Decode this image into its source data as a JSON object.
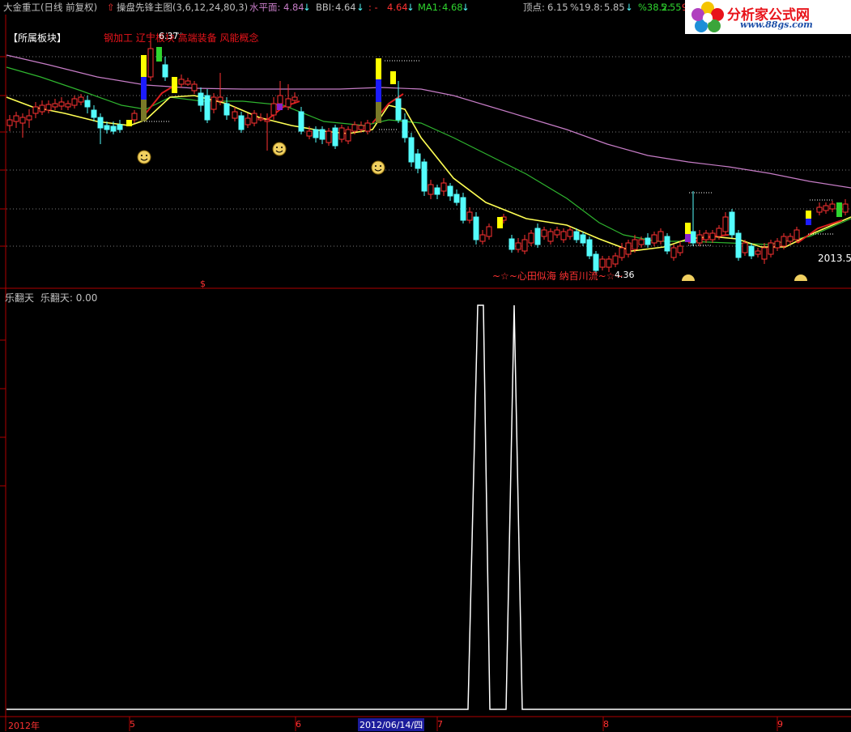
{
  "header": {
    "stock": "大金重工(日线 前复权)",
    "indicator_name": "操盘先锋主图(3,6,12,24,80,3)",
    "shuiping_label": "水平面:",
    "shuiping_value": "4.84",
    "bbi_label": "BBI:",
    "bbi_value": "4.64",
    "third_label": ": -",
    "third_value": "4.64",
    "ma1_label": "MA1:",
    "ma1_value": "4.68",
    "top_label": "顶点:",
    "top_value": "6.15",
    "pct1_label": "%19.8:",
    "pct1_value": "5.85",
    "pct2_label": "%38.2:",
    "pct2_value": "5.55",
    "pct3_label": "9"
  },
  "logo": {
    "title": "分析家公式网",
    "url": "www.88gs.com"
  },
  "main_panel": {
    "sector_button": "【所属板块】",
    "concept_tags": "钢加工  辽宁板块 高端装备 风能概念",
    "high_price_label": "6.37",
    "low_price_label": "4.36",
    "annotation": "~☆~心田似海  纳百川流~☆~",
    "year_right": "2013.5",
    "dollar_marker": "$",
    "colors": {
      "up_candle": "#ff3232",
      "down_candle": "#54fcfc",
      "ma_yellow": "#ffff54",
      "ma_green": "#2fb52f",
      "ma_violet": "#c77dc7",
      "trend_red": "#d81e1e"
    }
  },
  "sub_panel": {
    "title": "乐翻天",
    "value_label": "乐翻天:",
    "value": "0.00"
  },
  "x_axis": {
    "labels": [
      "2012年",
      "5",
      "6",
      "2012/06/14/四",
      "7",
      "8",
      "9"
    ]
  },
  "chart_data": [
    {
      "type": "candlestick",
      "series": [
        {
          "name": "水平面",
          "value": 4.84
        },
        {
          "name": "BBI",
          "value": 4.64
        },
        {
          "name": "MA1",
          "value": 4.68
        }
      ],
      "annotations": {
        "high": 6.37,
        "low": 4.36,
        "top": 6.15,
        "level_19_8": 5.85,
        "level_38_2": 5.55
      },
      "x_ticks": [
        "2012年",
        "5",
        "6",
        "7",
        "8",
        "9"
      ],
      "legend": "top"
    },
    {
      "type": "line",
      "title": "乐翻天",
      "series": [
        {
          "name": "乐翻天",
          "values": [
            0,
            0,
            1,
            1,
            0,
            0,
            1,
            0,
            0
          ]
        }
      ],
      "x": [
        "",
        "",
        "",
        "",
        "",
        "",
        "",
        "",
        ""
      ],
      "ylim": [
        0,
        1
      ]
    }
  ]
}
